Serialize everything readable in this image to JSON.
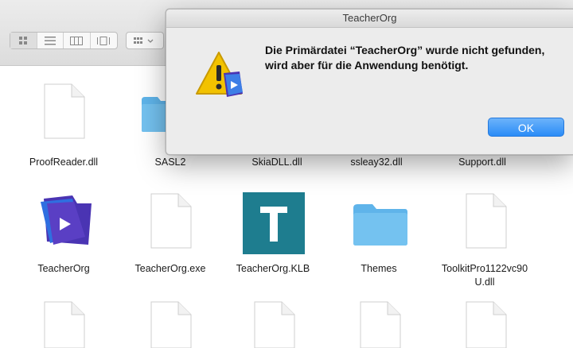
{
  "dialog": {
    "title": "TeacherOrg",
    "message": "Die Primärdatei “TeacherOrg” wurde nicht gefunden, wird aber für die Anwendung benötigt.",
    "ok_label": "OK"
  },
  "files": [
    {
      "name": "ProofReader.dll",
      "icon": "document-icon"
    },
    {
      "name": "SASL2",
      "icon": "folder-icon"
    },
    {
      "name": "SkiaDLL.dll",
      "icon": "document-icon"
    },
    {
      "name": "ssleay32.dll",
      "icon": "document-icon"
    },
    {
      "name": "Support.dll",
      "icon": "document-icon"
    },
    {
      "name": "TeacherOrg",
      "icon": "teacherorg-app-icon"
    },
    {
      "name": "TeacherOrg.exe",
      "icon": "document-icon"
    },
    {
      "name": "TeacherOrg.KLB",
      "icon": "klb-file-icon"
    },
    {
      "name": "Themes",
      "icon": "folder-icon"
    },
    {
      "name": "ToolkitPro1122vc90U.dll",
      "icon": "document-icon"
    }
  ],
  "colors": {
    "folder": "#5fb4ea",
    "klb_tile": "#1e7d8f",
    "ok_button": "#2a8cf7",
    "app_purple": "#5a3fc4"
  }
}
